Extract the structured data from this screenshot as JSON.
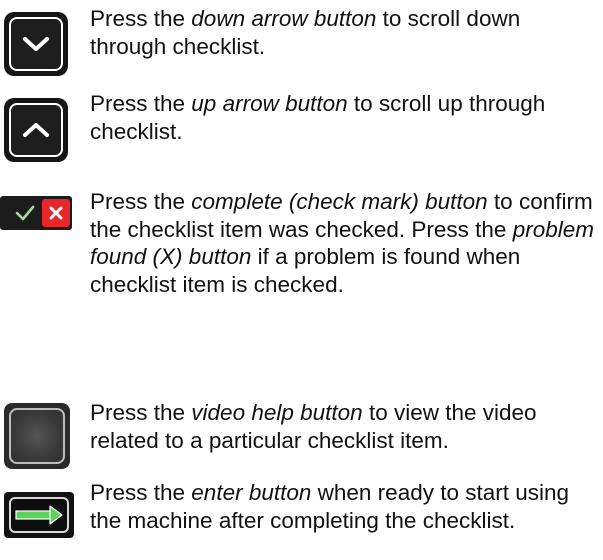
{
  "items": [
    {
      "icon": "chevron-down-icon",
      "text_before": "Press the ",
      "button_name": "down arrow button",
      "text_after": " to scroll down through checklist."
    },
    {
      "icon": "chevron-up-icon",
      "text_before": "Press the ",
      "button_name": "up arrow button",
      "text_after": " to scroll up through checklist."
    },
    {
      "icon": "check-x-icon",
      "text_before": "Press the ",
      "button_name": "complete (check mark) button",
      "text_middle": " to confirm the checklist item was checked. Press the ",
      "button_name_2": "problem found (X) button",
      "text_after": " if a problem is found when checklist item is checked."
    },
    {
      "icon": "video-help-icon",
      "text_before": "Press the ",
      "button_name": "video help button",
      "text_after": " to view the video related to a particular checklist item."
    },
    {
      "icon": "enter-arrow-icon",
      "text_before": "Press the ",
      "button_name": "enter button",
      "text_after": " when ready to start using the machine after completing the checklist."
    }
  ],
  "colors": {
    "button_dark": "#161616",
    "problem_red": "#e8262c",
    "check_green": "#7fc97a",
    "enter_green": "#5bd35a"
  }
}
